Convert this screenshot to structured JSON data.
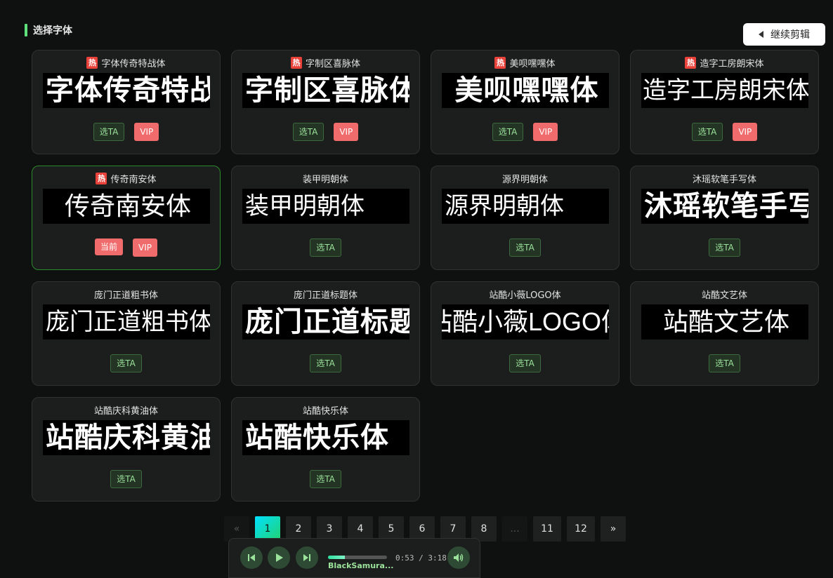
{
  "section_title": "选择字体",
  "continue_button": "继续剪辑",
  "labels": {
    "select": "选TA",
    "vip": "VIP",
    "current": "当前",
    "hot": "热"
  },
  "fonts": [
    {
      "name": "字体传奇特战体",
      "preview": "字体传奇特战体",
      "hot": true,
      "vip": true,
      "current": false,
      "style": "p-bold"
    },
    {
      "name": "字制区喜脉体",
      "preview": "字制区喜脉体",
      "hot": true,
      "vip": true,
      "current": false,
      "style": "p-bold"
    },
    {
      "name": "美呗嘿嘿体",
      "preview": "美呗嘿嘿体",
      "hot": true,
      "vip": true,
      "current": false,
      "style": "p-bold p-center"
    },
    {
      "name": "造字工房朗宋体",
      "preview": "造字工房朗宋体",
      "hot": true,
      "vip": true,
      "current": false,
      "style": "p-serif p-center"
    },
    {
      "name": "传奇南安体",
      "preview": "传奇南安体",
      "hot": true,
      "vip": true,
      "current": true,
      "style": "p-thin p-center"
    },
    {
      "name": "装甲明朝体",
      "preview": "装甲明朝体",
      "hot": false,
      "vip": false,
      "current": false,
      "style": "p-serif"
    },
    {
      "name": "源界明朝体",
      "preview": "源界明朝体",
      "hot": false,
      "vip": false,
      "current": false,
      "style": "p-serif"
    },
    {
      "name": "沐瑶软笔手写体",
      "preview": "沐瑶软笔手写体",
      "hot": false,
      "vip": false,
      "current": false,
      "style": "p-bold"
    },
    {
      "name": "庞门正道粗书体",
      "preview": "庞门正道粗书体",
      "hot": false,
      "vip": false,
      "current": false,
      "style": "p-serif"
    },
    {
      "name": "庞门正道标题体",
      "preview": "庞门正道标题体",
      "hot": false,
      "vip": false,
      "current": false,
      "style": "p-bold"
    },
    {
      "name": "站酷小薇LOGO体",
      "preview": "站酷小薇LOGO体",
      "hot": false,
      "vip": false,
      "current": false,
      "style": "p-thin"
    },
    {
      "name": "站酷文艺体",
      "preview": "站酷文艺体",
      "hot": false,
      "vip": false,
      "current": false,
      "style": "p-thin"
    },
    {
      "name": "站酷庆科黄油体",
      "preview": "站酷庆科黄油体",
      "hot": false,
      "vip": false,
      "current": false,
      "style": "p-bold"
    },
    {
      "name": "站酷快乐体",
      "preview": "站酷快乐体",
      "hot": false,
      "vip": false,
      "current": false,
      "style": "p-bold"
    }
  ],
  "pagination": {
    "prev": "«",
    "next": "»",
    "ellipsis": "...",
    "pages": [
      "1",
      "2",
      "3",
      "4",
      "5",
      "6",
      "7",
      "8"
    ],
    "tail_pages": [
      "11",
      "12"
    ],
    "current": "1"
  },
  "player": {
    "track": "BlackSamura...",
    "time": "0:53 / 3:18",
    "progress_percent": 28,
    "icons": {
      "prev": "skip-previous-icon",
      "play": "play-icon",
      "next": "skip-next-icon",
      "volume": "volume-icon"
    }
  }
}
